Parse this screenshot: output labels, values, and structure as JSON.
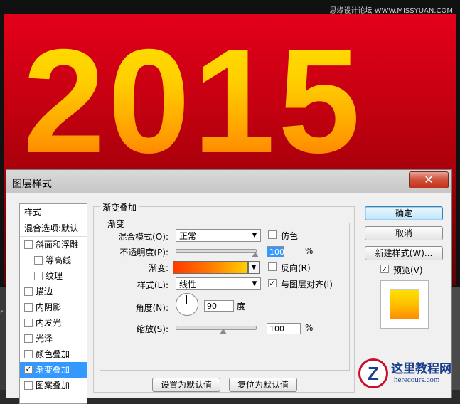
{
  "watermark": "思缘设计论坛 WWW.MISSYUAN.COM",
  "poster": {
    "year": "2015"
  },
  "left_strip_char": "ri",
  "dialog": {
    "title": "图层样式",
    "close_glyph": "✕",
    "styles_panel": {
      "header": "样式",
      "blend_options": "混合选项:默认",
      "items": [
        {
          "label": "斜面和浮雕",
          "checked": false,
          "indent": false,
          "selected": false
        },
        {
          "label": "等高线",
          "checked": false,
          "indent": true,
          "selected": false
        },
        {
          "label": "纹理",
          "checked": false,
          "indent": true,
          "selected": false
        },
        {
          "label": "描边",
          "checked": false,
          "indent": false,
          "selected": false
        },
        {
          "label": "内阴影",
          "checked": false,
          "indent": false,
          "selected": false
        },
        {
          "label": "内发光",
          "checked": false,
          "indent": false,
          "selected": false
        },
        {
          "label": "光泽",
          "checked": false,
          "indent": false,
          "selected": false
        },
        {
          "label": "颜色叠加",
          "checked": false,
          "indent": false,
          "selected": false
        },
        {
          "label": "渐变叠加",
          "checked": true,
          "indent": false,
          "selected": true
        },
        {
          "label": "图案叠加",
          "checked": false,
          "indent": false,
          "selected": false
        }
      ]
    },
    "gradient_overlay": {
      "group_title": "渐变叠加",
      "subgroup_title": "渐变",
      "blend_mode_label": "混合模式(O):",
      "blend_mode_value": "正常",
      "dither_label": "仿色",
      "dither_checked": false,
      "opacity_label": "不透明度(P):",
      "opacity_value": "100",
      "opacity_unit": "%",
      "opacity_fraction": 1.0,
      "gradient_label": "渐变:",
      "gradient_colors": [
        "#ff3a00",
        "#ff7a00",
        "#ffd000"
      ],
      "reverse_label": "反向(R)",
      "reverse_checked": false,
      "style_label": "样式(L):",
      "style_value": "线性",
      "align_label": "与图层对齐(I)",
      "align_checked": true,
      "angle_label": "角度(N):",
      "angle_value": "90",
      "angle_unit": "度",
      "scale_label": "缩放(S):",
      "scale_value": "100",
      "scale_unit": "%",
      "scale_fraction": 0.6,
      "make_default": "设置为默认值",
      "reset_default": "复位为默认值"
    },
    "buttons": {
      "ok": "确定",
      "cancel": "取消",
      "new_style": "新建样式(W)...",
      "preview_label": "预览(V)",
      "preview_checked": true
    }
  },
  "logo": {
    "mark": "Z",
    "name_cn": "这里教程网",
    "domain": "herecours.com"
  }
}
